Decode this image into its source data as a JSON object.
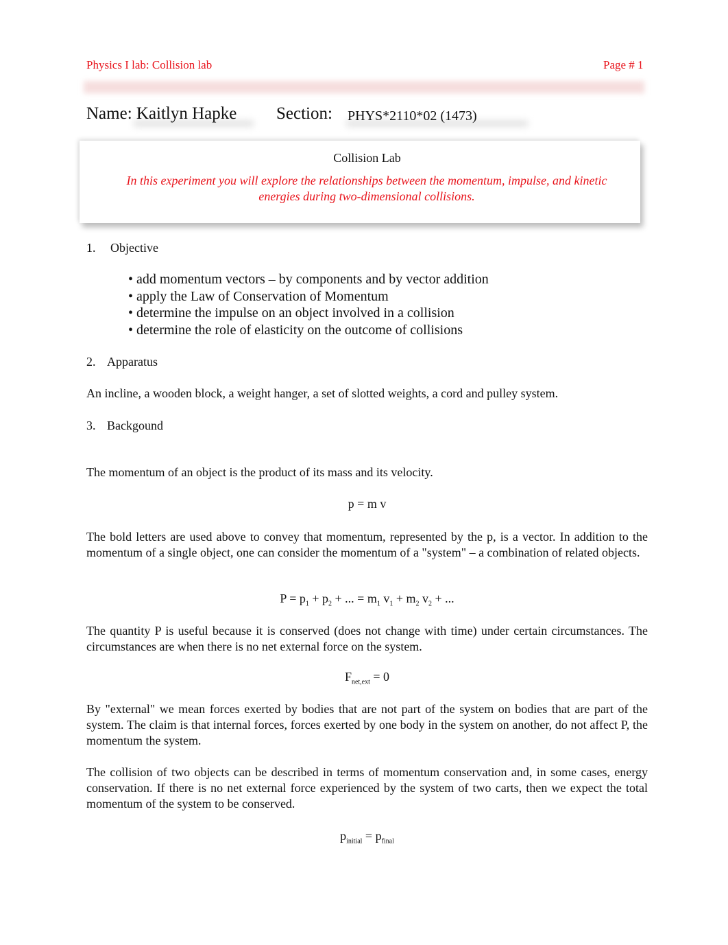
{
  "header": {
    "left": "Physics I lab:  Collision lab",
    "right": "Page # 1",
    "accent": "#e8141c"
  },
  "name_line": {
    "name_label": "Name: Kaitlyn Hapke",
    "section_label": "Section:",
    "section_value": "PHYS*2110*02 (1473)"
  },
  "title_box": {
    "title": "Collision Lab",
    "intro": "In this experiment you will explore the relationships between the momentum, impulse, and kinetic energies during two-dimensional collisions."
  },
  "sections": [
    {
      "num": "1.",
      "title": "Objective",
      "bullets": [
        "• add momentum vectors – by components and by vector addition",
        "• apply the Law of Conservation of Momentum",
        "• determine the impulse on an object involved in a collision",
        "• determine the role of elasticity on the outcome of collisions"
      ]
    },
    {
      "num": "2.",
      "title": "Apparatus",
      "text": "An incline, a wooden block, a weight hanger, a set of slotted weights, a cord and pulley system."
    },
    {
      "num": "3.",
      "title": "Backgound"
    }
  ],
  "background": {
    "p1": "The momentum of an object is the product of its mass and its velocity.",
    "eq1": "p = m v",
    "p2": "The bold letters are used above to convey that momentum, represented by the p, is a vector. In addition to the momentum of a single object, one can consider the momentum of a \"system\" – a combination of related objects.",
    "eq2": {
      "a": "P = p",
      "s1": "1",
      "b": " + p",
      "s2": "2",
      "c": " + ... = m",
      "s3": "1",
      "d": " v",
      "s4": "1",
      "e": " + m",
      "s5": "2",
      "f": " v",
      "s6": "2",
      "g": " + ..."
    },
    "p3": "The quantity P is useful because it is conserved (does not change with time) under certain circumstances. The circumstances are when there is no net external force on the system.",
    "eq3": {
      "a": "F",
      "s": "net,ext",
      "b": " = 0"
    },
    "p4": "By \"external\" we mean forces exerted by bodies that are not part of the system on bodies that are part of the system. The claim is that internal forces, forces exerted by one body in the system on another, do not affect P, the momentum the system.",
    "p5": "The collision of two objects can be described in terms of momentum conservation and, in some cases, energy conservation. If there is no net external force experienced by the system of two carts, then we expect the total momentum of the system to be conserved.",
    "eq4": {
      "a": "p",
      "s1": "initial",
      "b": " = p",
      "s2": "final"
    }
  }
}
